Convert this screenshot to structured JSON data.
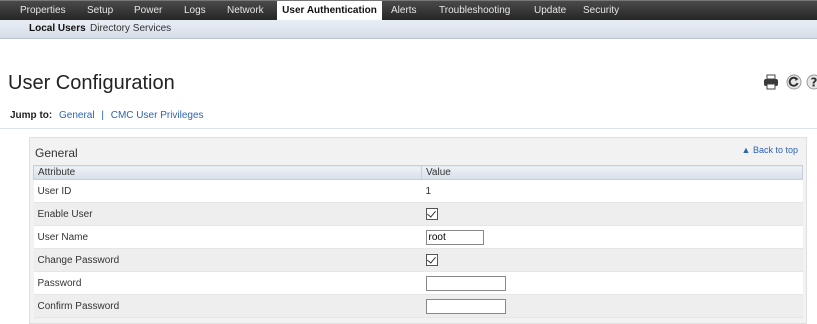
{
  "top_nav": {
    "tabs": [
      {
        "label": "Properties"
      },
      {
        "label": "Setup"
      },
      {
        "label": "Power"
      },
      {
        "label": "Logs"
      },
      {
        "label": "Network"
      },
      {
        "label": "User Authentication",
        "active": true
      },
      {
        "label": "Alerts"
      },
      {
        "label": "Troubleshooting"
      },
      {
        "label": "Update"
      },
      {
        "label": "Security"
      }
    ]
  },
  "sub_nav": {
    "items": [
      {
        "label": "Local Users",
        "active": true
      },
      {
        "label": "Directory Services"
      }
    ]
  },
  "page": {
    "title": "User Configuration",
    "toolbar_icons": [
      "print-icon",
      "refresh-icon",
      "help-icon"
    ]
  },
  "jump_to": {
    "label": "Jump to:",
    "links": [
      "General",
      "CMC User Privileges"
    ],
    "separator": "|"
  },
  "general": {
    "title": "General",
    "back_to_top": "Back to top",
    "columns": [
      "Attribute",
      "Value"
    ],
    "rows": [
      {
        "attribute": "User ID",
        "type": "text",
        "value": "1"
      },
      {
        "attribute": "Enable User",
        "type": "checkbox",
        "checked": true
      },
      {
        "attribute": "User Name",
        "type": "input",
        "value": "root"
      },
      {
        "attribute": "Change Password",
        "type": "checkbox",
        "checked": true
      },
      {
        "attribute": "Password",
        "type": "password",
        "value": ""
      },
      {
        "attribute": "Confirm Password",
        "type": "password",
        "value": ""
      }
    ]
  },
  "colors": {
    "nav_dark": "#262626",
    "subnav_blue": "#d5dde8",
    "link_blue": "#2e65b0"
  }
}
